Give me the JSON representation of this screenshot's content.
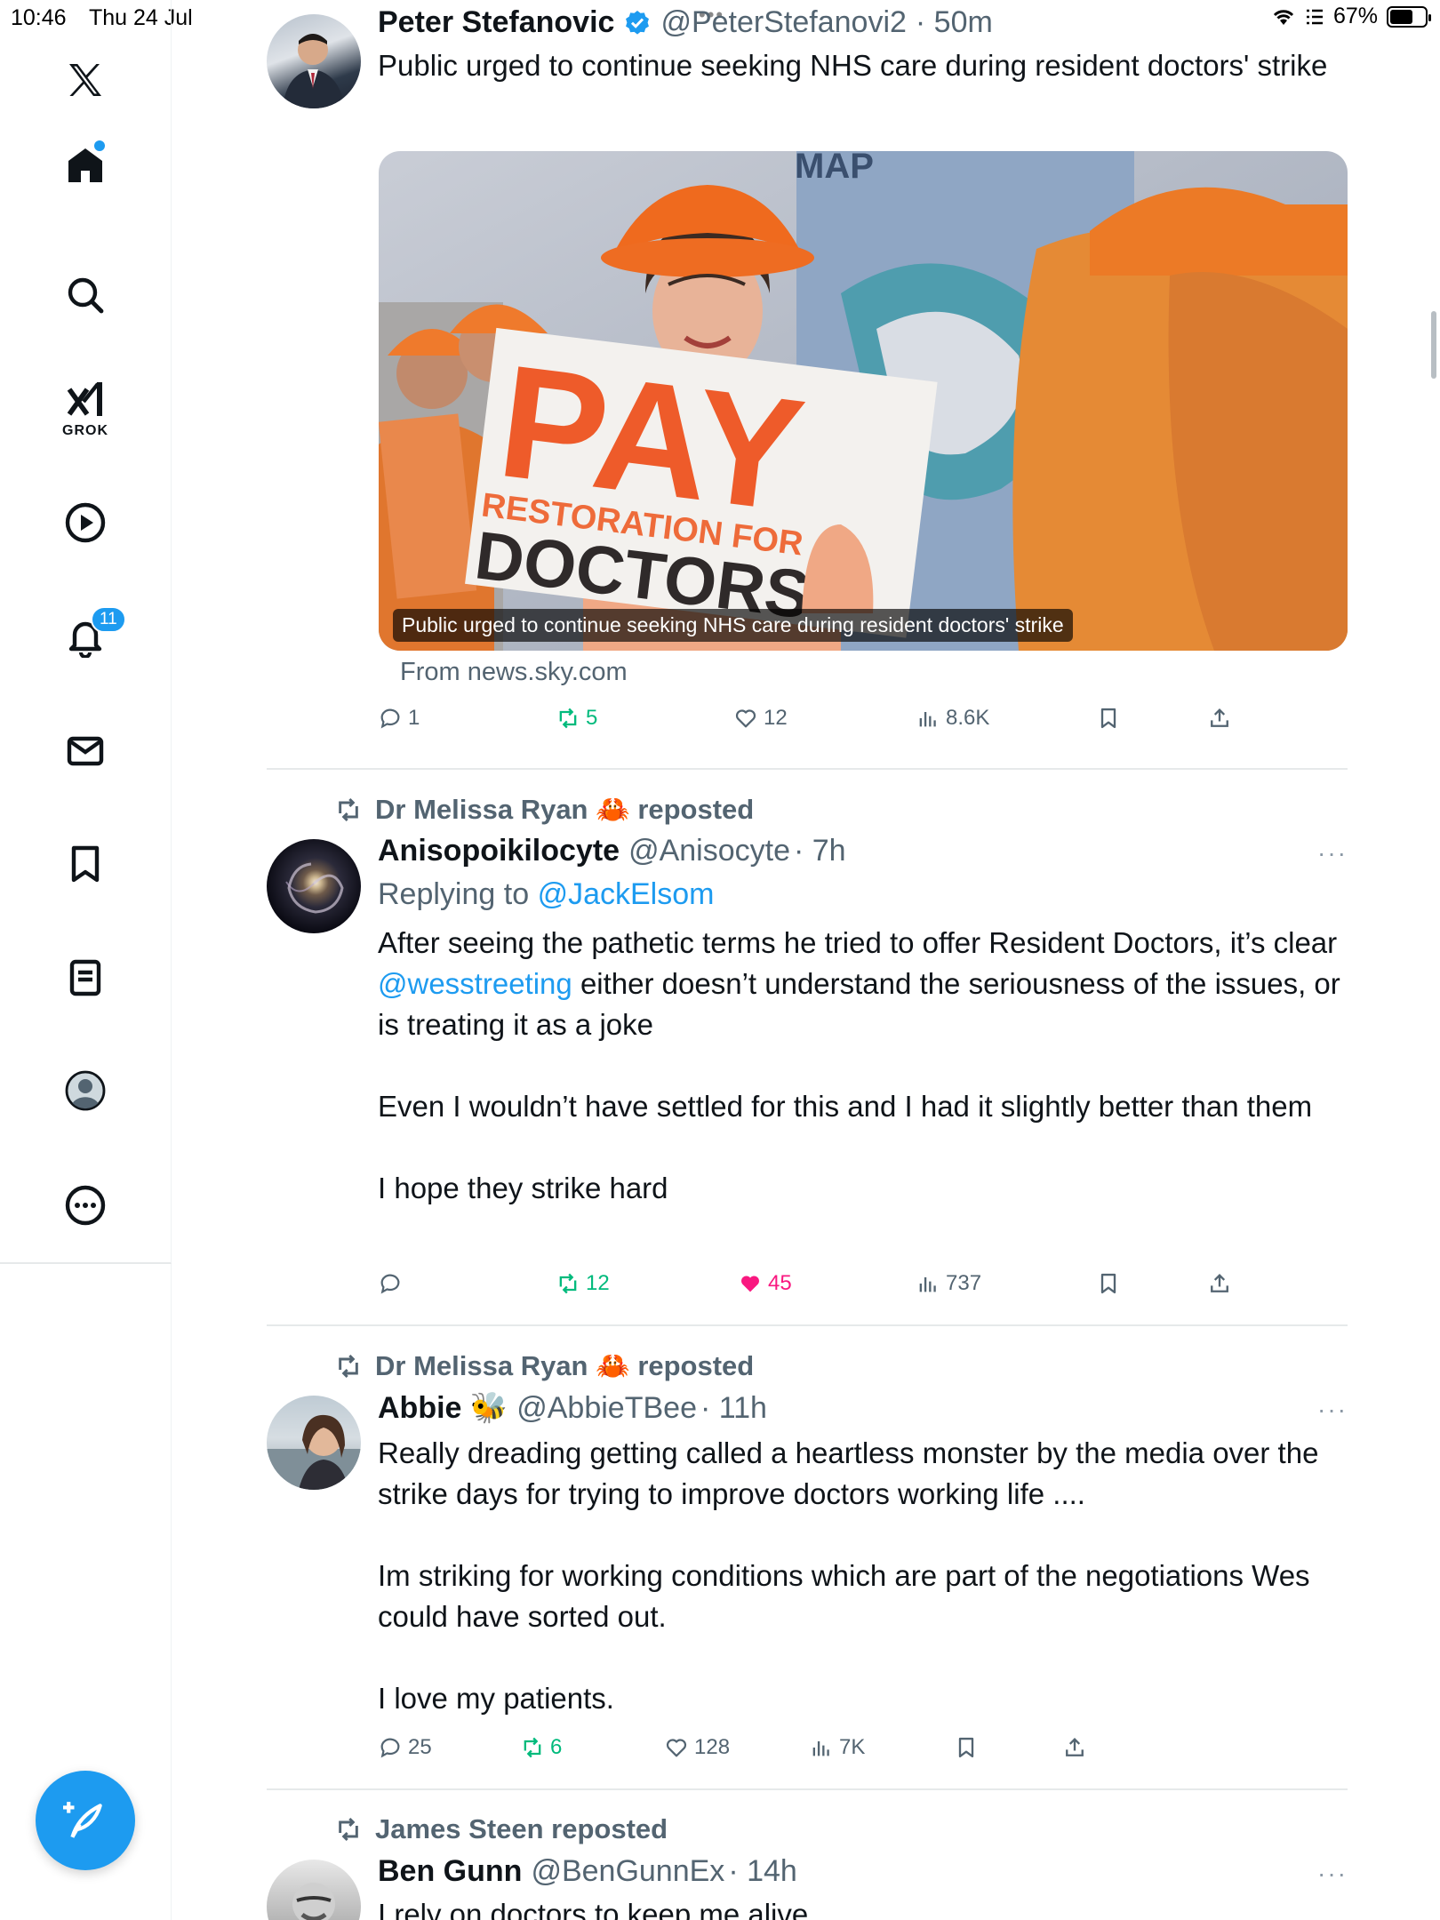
{
  "status_bar": {
    "time": "10:46",
    "date": "Thu 24 Jul",
    "battery": "67%",
    "battery_level": 0.67,
    "top_dots": "•••"
  },
  "sidebar": {
    "items": [
      {
        "name": "x-logo",
        "icon": "x-icon"
      },
      {
        "name": "home",
        "icon": "home-icon",
        "has_dot": true
      },
      {
        "name": "explore",
        "icon": "search-icon"
      },
      {
        "name": "grok",
        "icon": "grok-icon",
        "label": "GROK"
      },
      {
        "name": "video",
        "icon": "play-icon"
      },
      {
        "name": "notifications",
        "icon": "bell-icon",
        "badge": "11"
      },
      {
        "name": "messages",
        "icon": "mail-icon"
      },
      {
        "name": "bookmarks",
        "icon": "bookmark-icon"
      },
      {
        "name": "lists",
        "icon": "list-icon"
      },
      {
        "name": "profile",
        "icon": "profile-icon"
      },
      {
        "name": "more",
        "icon": "more-icon"
      }
    ],
    "compose_icon": "compose-icon"
  },
  "feed": {
    "tweets": [
      {
        "name": "Peter Stefanovic",
        "verified": true,
        "handle": "@PeterStefanovi2",
        "time": "· 50m",
        "text": "Public urged to continue seeking NHS care during resident doctors' strike",
        "card": {
          "caption": "Public urged to continue seeking NHS care during resident doctors' strike",
          "source": "From news.sky.com",
          "sign_line1": "PAY",
          "sign_line2": "RESTORATION FOR",
          "sign_line3": "DOCTORS",
          "map_label": "MAP"
        },
        "stats": {
          "replies": "1",
          "reposts": "5",
          "likes": "12",
          "views": "8.6K"
        }
      },
      {
        "repost_by": "Dr Melissa Ryan 🦀 reposted",
        "name": "Anisopoikilocyte",
        "handle": "@Anisocyte",
        "time": "· 7h",
        "more": "···",
        "reply_prefix": "Replying to",
        "reply_to": "@JackElsom",
        "text_p1a": "After seeing the pathetic terms he tried to offer Resident Doctors, it’s clear",
        "text_p1_mention": "@wesstreeting",
        "text_p1b": "either doesn’t understand the seriousness of the issues, or is treating it as a joke",
        "text_p2": "Even I wouldn’t have settled for this and I had it slightly better than them",
        "text_p3": "I hope they strike hard",
        "stats": {
          "replies": "",
          "reposts": "12",
          "likes": "45",
          "views": "737"
        },
        "liked": true
      },
      {
        "repost_by": "Dr Melissa Ryan 🦀 reposted",
        "name": "Abbie 🐝",
        "handle": "@AbbieTBee",
        "time": "· 11h",
        "more": "···",
        "text_p1": "Really dreading getting called a heartless monster by the media over the strike days for trying to improve doctors working life ....",
        "text_p2": "Im striking for working conditions which are part of the negotiations Wes could have sorted out.",
        "text_p3": "I love my patients.",
        "stats": {
          "replies": "25",
          "reposts": "6",
          "likes": "128",
          "views": "7K"
        }
      },
      {
        "repost_by": "James Steen reposted",
        "name": "Ben Gunn",
        "handle": "@BenGunnEx",
        "time": "· 14h",
        "more": "···",
        "text_p1": "I rely on doctors to keep me alive..."
      }
    ]
  },
  "colors": {
    "accent": "#1d9bf0",
    "text": "#0f1419",
    "secondary": "#536471",
    "repost_green": "#00ba7c",
    "like_pink": "#f91880"
  }
}
